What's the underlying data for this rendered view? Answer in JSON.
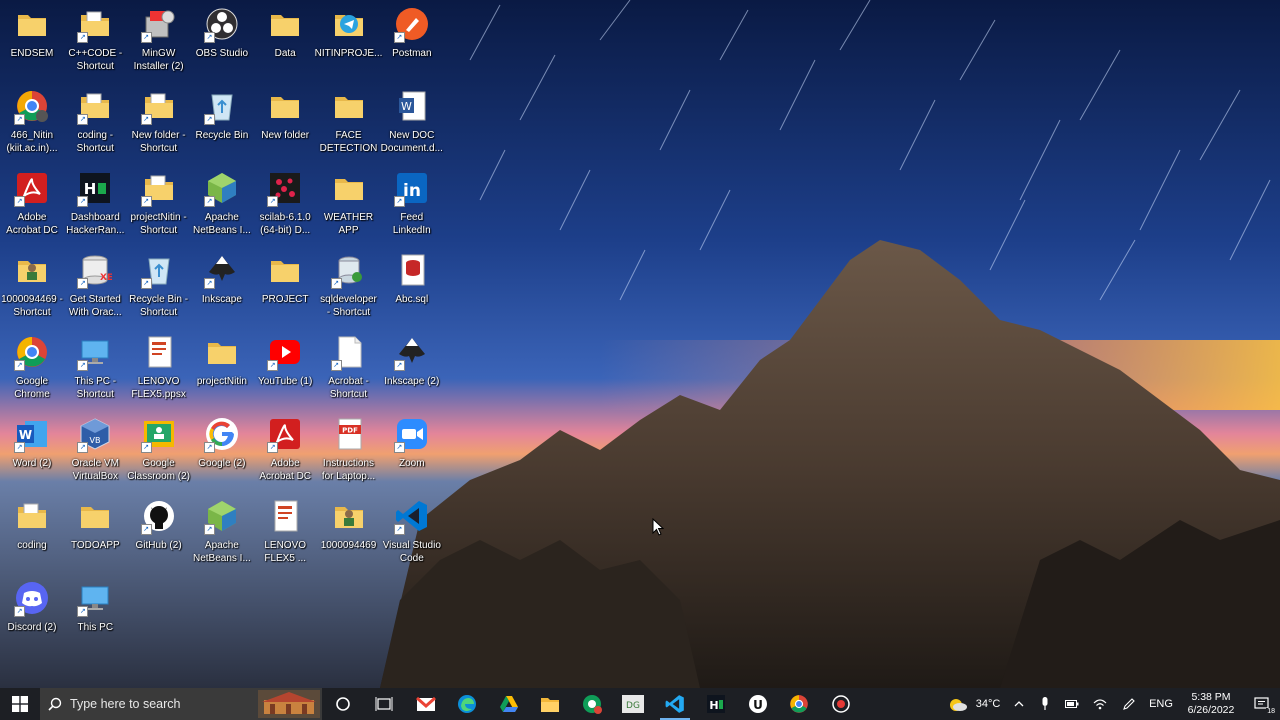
{
  "desktop": {
    "icons": [
      {
        "label": "ENDSEM",
        "kind": "folder"
      },
      {
        "label": "C++CODE -\nShortcut",
        "kind": "folder-doc"
      },
      {
        "label": "MinGW\nInstaller (2)",
        "kind": "installer"
      },
      {
        "label": "OBS Studio",
        "kind": "obs"
      },
      {
        "label": "Data",
        "kind": "folder"
      },
      {
        "label": "NITINPROJE...",
        "kind": "telegram"
      },
      {
        "label": "Postman",
        "kind": "postman"
      },
      {
        "label": "466_Nitin\n(kiit.ac.in)...",
        "kind": "chrome-profile"
      },
      {
        "label": "coding -\nShortcut",
        "kind": "folder-doc"
      },
      {
        "label": "New folder -\nShortcut",
        "kind": "folder-doc"
      },
      {
        "label": "Recycle Bin",
        "kind": "recycle"
      },
      {
        "label": "New folder",
        "kind": "folder"
      },
      {
        "label": "FACE\nDETECTION",
        "kind": "folder"
      },
      {
        "label": "New DOC\nDocument.d...",
        "kind": "word-doc"
      },
      {
        "label": "Adobe\nAcrobat DC",
        "kind": "acrobat"
      },
      {
        "label": "Dashboard\nHackerRan...",
        "kind": "hackerrank"
      },
      {
        "label": "projectNitin -\nShortcut",
        "kind": "folder-doc"
      },
      {
        "label": "Apache\nNetBeans I...",
        "kind": "netbeans"
      },
      {
        "label": "scilab-6.1.0\n(64-bit) D...",
        "kind": "scilab"
      },
      {
        "label": "WEATHER\nAPP",
        "kind": "folder"
      },
      {
        "label": "Feed\nLinkedIn",
        "kind": "linkedin"
      },
      {
        "label": "1000094469 -\nShortcut",
        "kind": "folder-person"
      },
      {
        "label": "Get Started\nWith Orac...",
        "kind": "oracle-db"
      },
      {
        "label": "Recycle Bin -\nShortcut",
        "kind": "recycle"
      },
      {
        "label": "Inkscape",
        "kind": "inkscape"
      },
      {
        "label": "PROJECT",
        "kind": "folder"
      },
      {
        "label": "sqldeveloper\n- Shortcut",
        "kind": "sqldev"
      },
      {
        "label": "Abc.sql",
        "kind": "sql-file"
      },
      {
        "label": "Google\nChrome",
        "kind": "chrome"
      },
      {
        "label": "This PC -\nShortcut",
        "kind": "thispc"
      },
      {
        "label": "LENOVO\nFLEX5.ppsx",
        "kind": "ppt"
      },
      {
        "label": "projectNitin",
        "kind": "folder"
      },
      {
        "label": "YouTube (1)",
        "kind": "youtube"
      },
      {
        "label": "Acrobat -\nShortcut",
        "kind": "blank-doc"
      },
      {
        "label": "Inkscape (2)",
        "kind": "inkscape"
      },
      {
        "label": "Word (2)",
        "kind": "word"
      },
      {
        "label": "Oracle VM\nVirtualBox",
        "kind": "virtualbox"
      },
      {
        "label": "Google\nClassroom (2)",
        "kind": "classroom"
      },
      {
        "label": "Google (2)",
        "kind": "google"
      },
      {
        "label": "Adobe\nAcrobat DC",
        "kind": "acrobat"
      },
      {
        "label": "Instructions\nfor Laptop...",
        "kind": "pdf"
      },
      {
        "label": "Zoom",
        "kind": "zoom"
      },
      {
        "label": "coding",
        "kind": "folder-doc"
      },
      {
        "label": "TODOAPP",
        "kind": "folder"
      },
      {
        "label": "GitHub (2)",
        "kind": "github"
      },
      {
        "label": "Apache\nNetBeans I...",
        "kind": "netbeans"
      },
      {
        "label": "LENOVO\nFLEX5 ...",
        "kind": "ppt"
      },
      {
        "label": "1000094469",
        "kind": "folder-person"
      },
      {
        "label": "Visual Studio\nCode",
        "kind": "vscode"
      },
      {
        "label": "Discord (2)",
        "kind": "discord"
      },
      {
        "label": "This PC",
        "kind": "thispc"
      }
    ]
  },
  "taskbar": {
    "search_placeholder": "Type here to search",
    "pinned": [
      {
        "name": "cortana-icon"
      },
      {
        "name": "task-view-icon"
      },
      {
        "name": "gmail-icon"
      },
      {
        "name": "edge-icon"
      },
      {
        "name": "google-drive-icon"
      },
      {
        "name": "file-explorer-icon"
      },
      {
        "name": "chrome-badge-icon"
      },
      {
        "name": "app-dg-icon"
      },
      {
        "name": "vscode-taskbar-icon",
        "active": true
      },
      {
        "name": "hackerrank-taskbar-icon"
      },
      {
        "name": "u-app-icon"
      },
      {
        "name": "chrome-taskbar-icon"
      },
      {
        "name": "recorder-icon"
      }
    ],
    "weather": {
      "temp": "34°C"
    },
    "language": "ENG",
    "clock": {
      "time": "5:38 PM",
      "date": "6/26/2022"
    },
    "notification_count": "18"
  }
}
